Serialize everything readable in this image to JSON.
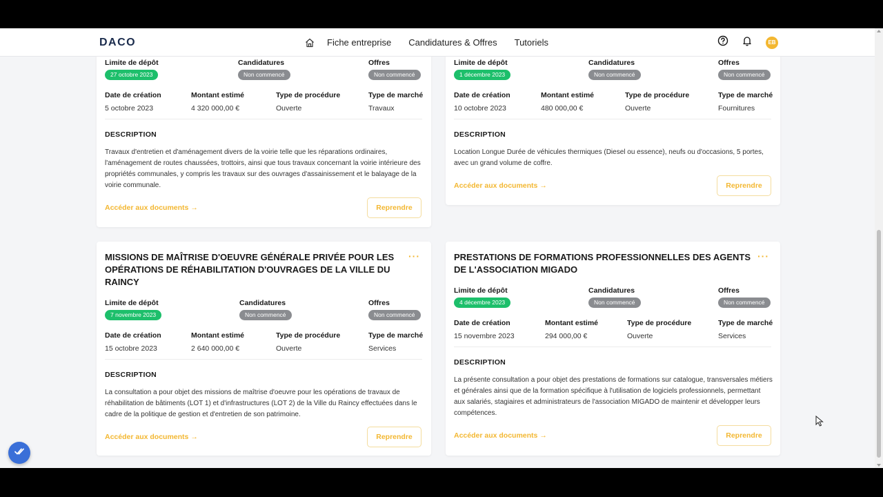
{
  "header": {
    "logo": "DACO",
    "nav": [
      "Fiche entreprise",
      "Candidatures & Offres",
      "Tutoriels"
    ],
    "avatar_initials": "EB",
    "accent_color": "#f3b731"
  },
  "labels": {
    "deadline": "Limite de dépôt",
    "applications": "Candidatures",
    "offers": "Offres",
    "created": "Date de création",
    "amount": "Montant estimé",
    "procedure": "Type de procédure",
    "market": "Type de marché",
    "description": "DESCRIPTION",
    "documents_link": "Accéder aux documents",
    "resume_button": "Reprendre"
  },
  "cards": [
    {
      "title": "",
      "deadline": "27 octobre 2023",
      "applications_status": "Non commencé",
      "offers_status": "Non commencé",
      "created": "5 octobre 2023",
      "amount": "4 320 000,00 €",
      "procedure": "Ouverte",
      "market": "Travaux",
      "description": "Travaux d'entretien et d'aménagement divers de la voirie telle que les réparations ordinaires, l'aménagement de routes chaussées, trottoirs, ainsi que tous travaux concernant la voirie intérieure des propriétés communales, y compris les travaux sur des ouvrages d'assainissement et le balayage de la voirie communale."
    },
    {
      "title": "",
      "deadline": "1 décembre 2023",
      "applications_status": "Non commencé",
      "offers_status": "Non commencé",
      "created": "10 octobre 2023",
      "amount": "480 000,00 €",
      "procedure": "Ouverte",
      "market": "Fournitures",
      "description": "Location Longue Durée de véhicules thermiques (Diesel ou essence), neufs ou d'occasions, 5 portes, avec un grand volume de coffre."
    },
    {
      "title": "MISSIONS DE MAÎTRISE D'OEUVRE GÉNÉRALE PRIVÉE POUR LES OPÉRATIONS DE RÉHABILITATION D'OUVRAGES DE LA VILLE DU RAINCY",
      "deadline": "7 novembre 2023",
      "applications_status": "Non commencé",
      "offers_status": "Non commencé",
      "created": "15 octobre 2023",
      "amount": "2 640 000,00 €",
      "procedure": "Ouverte",
      "market": "Services",
      "description": "La consultation a pour objet des missions de maîtrise d'oeuvre pour les opérations de travaux de réhabilitation de bâtiments (LOT 1) et d'infrastructures (LOT 2) de la Ville du Raincy effectuées dans le cadre de la politique de gestion et d'entretien de son patrimoine."
    },
    {
      "title": "PRESTATIONS DE FORMATIONS PROFESSIONNELLES DES AGENTS DE L'ASSOCIATION MIGADO",
      "deadline": "4 décembre 2023",
      "applications_status": "Non commencé",
      "offers_status": "Non commencé",
      "created": "15 novembre 2023",
      "amount": "294 000,00 €",
      "procedure": "Ouverte",
      "market": "Services",
      "description": "La présente consultation a pour objet des prestations de formations sur catalogue, transversales métiers et générales ainsi que de la formation spécifique à l'utilisation de logiciels professionnels, permettant aux salariés, stagiaires et administrateurs de l'association MIGADO de maintenir et développer leurs compétences."
    }
  ]
}
